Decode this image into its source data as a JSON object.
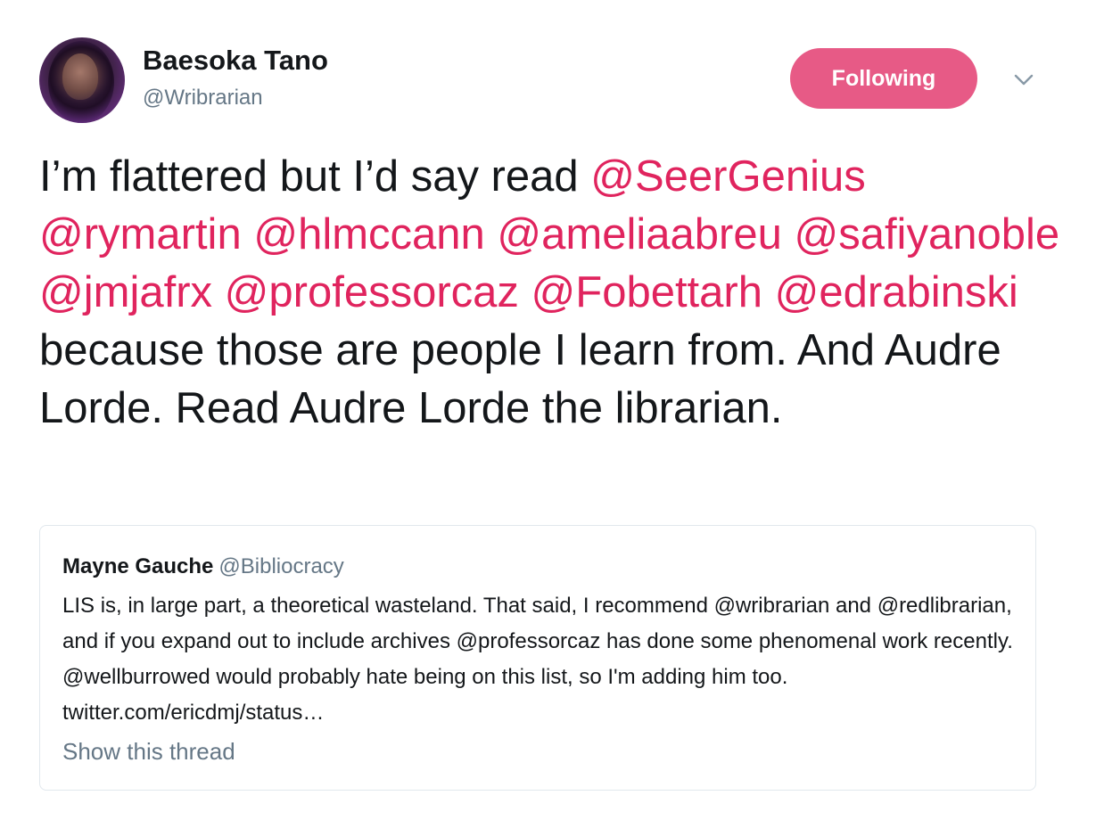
{
  "author": {
    "name": "Baesoka Tano",
    "handle": "@Wribrarian",
    "follow_label": "Following"
  },
  "tweet": {
    "segments": [
      {
        "text": "I’m flattered but I’d say read ",
        "mention": false
      },
      {
        "text": "@SeerGenius",
        "mention": true
      },
      {
        "text": " ",
        "mention": false
      },
      {
        "text": "@rymartin",
        "mention": true
      },
      {
        "text": " ",
        "mention": false
      },
      {
        "text": "@hlmccann",
        "mention": true
      },
      {
        "text": " ",
        "mention": false
      },
      {
        "text": "@ameliaabreu",
        "mention": true
      },
      {
        "text": " ",
        "mention": false
      },
      {
        "text": "@safiyanoble",
        "mention": true
      },
      {
        "text": " ",
        "mention": false
      },
      {
        "text": "@jmjafrx",
        "mention": true
      },
      {
        "text": " ",
        "mention": false
      },
      {
        "text": "@professorcaz",
        "mention": true
      },
      {
        "text": " ",
        "mention": false
      },
      {
        "text": "@Fobettarh",
        "mention": true
      },
      {
        "text": " ",
        "mention": false
      },
      {
        "text": "@edrabinski",
        "mention": true
      },
      {
        "text": " because those are people I learn from. And Audre Lorde. Read Audre Lorde the librarian.",
        "mention": false
      }
    ]
  },
  "quoted": {
    "name": "Mayne Gauche",
    "handle": "@Bibliocracy",
    "text": "LIS is, in large part, a theoretical wasteland. That said, I recommend @wribrarian and @redlibrarian, and if you expand out to include archives @professorcaz has done some phenomenal work recently. @wellburrowed would probably hate being on this list, so I'm adding him too. twitter.com/ericdmj/status…",
    "thread_label": "Show this thread"
  },
  "colors": {
    "mention": "#e0245e",
    "secondary_text": "#657786",
    "primary_text": "#14171a"
  },
  "icons": {
    "caret": "chevron-down-icon"
  }
}
